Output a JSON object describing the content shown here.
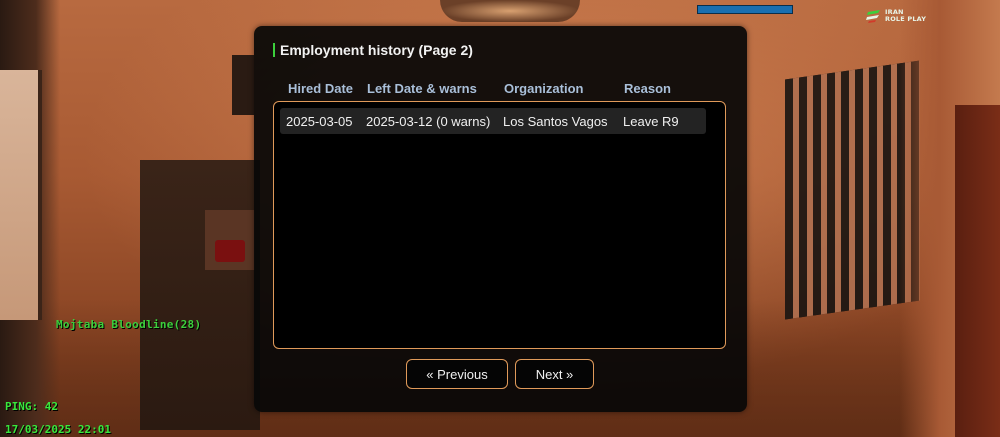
{
  "dialog": {
    "title": "Employment history (Page 2)",
    "columns": [
      "Hired Date",
      "Left Date & warns",
      "Organization",
      "Reason"
    ],
    "rows": [
      {
        "hired_date": "2025-03-05",
        "left_date_warns": "2025-03-12 (0 warns)",
        "organization": "Los Santos Vagos",
        "reason": "Leave R9"
      }
    ],
    "buttons": {
      "previous": "« Previous",
      "next": "Next »"
    }
  },
  "hud": {
    "logo_line1": "IRAN",
    "logo_line2": "ROLE PLAY",
    "player_tag": "Mojtaba Bloodline(28)",
    "ping": "PING: 42",
    "datetime": "17/03/2025 22:01",
    "health_bar_color": "#1a6fb0"
  },
  "colors": {
    "accent_border": "#e09a5a",
    "header_text": "#a9bfd9",
    "hud_green": "#39e83c",
    "title_accent": "#3ccf3c"
  },
  "icons": {
    "logo": "iran-roleplay-logo-icon"
  }
}
